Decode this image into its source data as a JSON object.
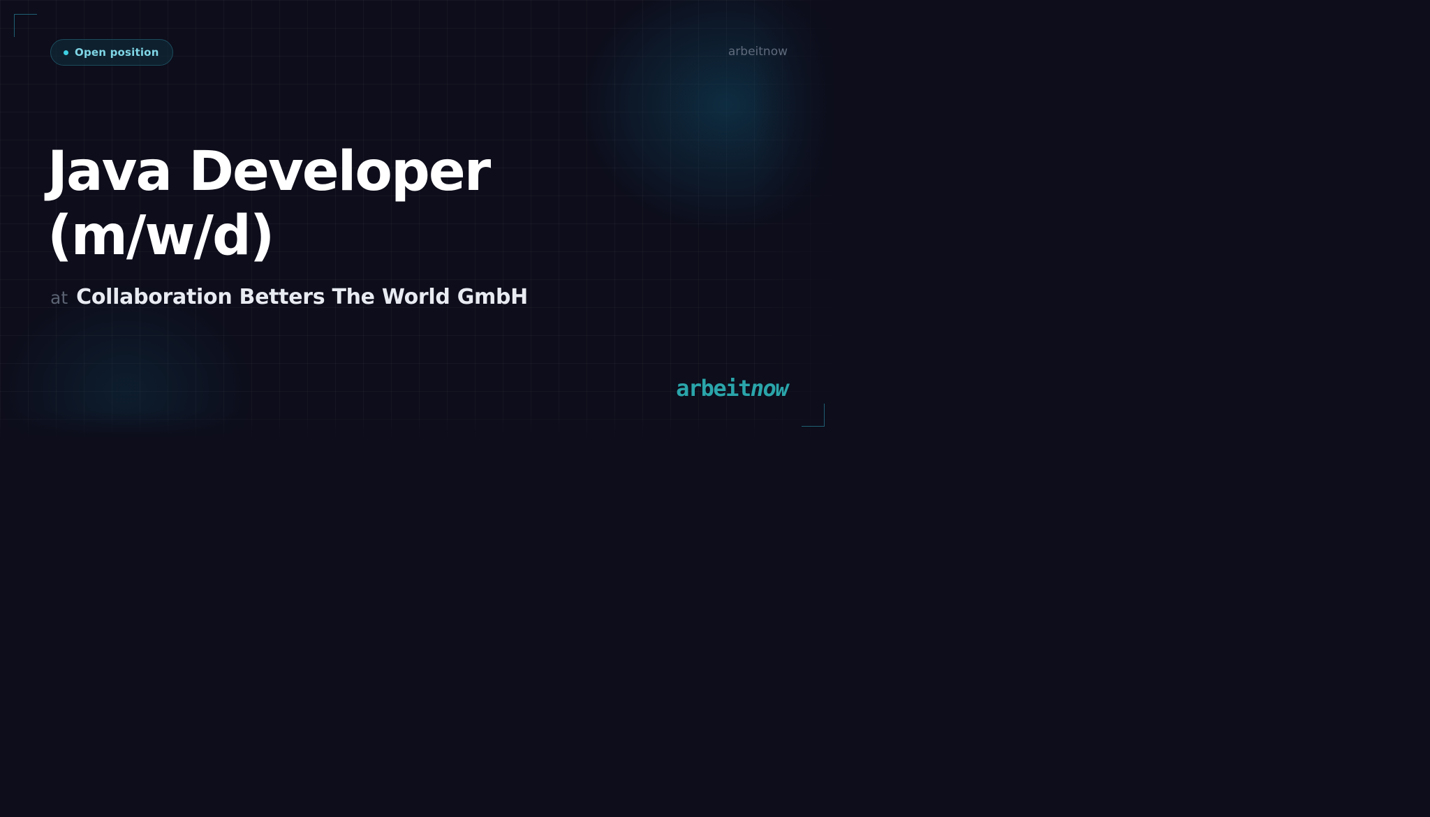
{
  "badge": {
    "label": "Open position",
    "dot_color": "#3ed0e3"
  },
  "header": {
    "brand": "arbeitnow"
  },
  "job": {
    "title_line1": "Java Developer",
    "title_line2": "(m/w/d)",
    "at_label": "at",
    "company": "Collaboration Betters The World GmbH"
  },
  "logo": {
    "part1": "arbeit",
    "part2": "now",
    "color": "#2aa5aa"
  },
  "colors": {
    "background": "#0d0d1b",
    "accent": "#3ed0e3",
    "title": "#ffffff"
  }
}
